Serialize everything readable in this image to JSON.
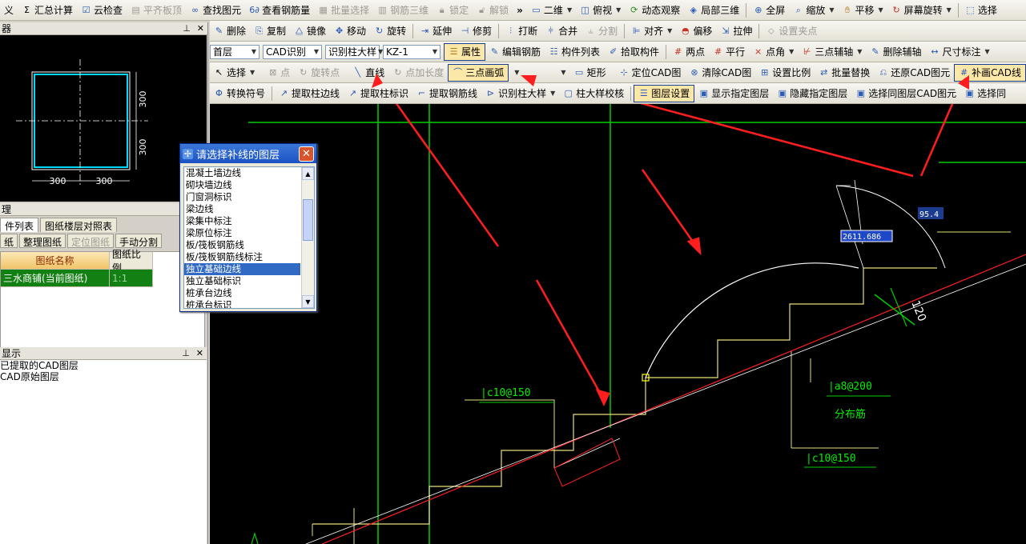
{
  "toolbar1": {
    "items": [
      "义",
      "汇总计算",
      "云检查",
      "平齐板顶",
      "查找图元",
      "查看钢筋量",
      "批量选择",
      "钢筋三维",
      "锁定",
      "解锁",
      "二维",
      "俯视",
      "动态观察",
      "局部三维",
      "全屏",
      "缩放",
      "平移",
      "屏幕旋转",
      "选择"
    ]
  },
  "toolbar2": {
    "panel_title": "器",
    "items": [
      "删除",
      "复制",
      "镜像",
      "移动",
      "旋转",
      "延伸",
      "修剪",
      "打断",
      "合并",
      "分割",
      "对齐",
      "偏移",
      "拉伸",
      "设置夹点"
    ]
  },
  "toolbar3": {
    "floor": "首层",
    "cad_recognize": "CAD识别",
    "recognize_col": "识别柱大样",
    "element": "KZ-1",
    "items": [
      "属性",
      "编辑钢筋",
      "构件列表",
      "拾取构件",
      "两点",
      "平行",
      "点角",
      "三点辅轴",
      "删除辅轴",
      "尺寸标注"
    ]
  },
  "toolbar4": {
    "items": [
      "选择",
      "点",
      "旋转点",
      "直线",
      "点加长度",
      "三点画弧",
      "矩形",
      "定位CAD图",
      "清除CAD图",
      "设置比例",
      "批量替换",
      "还原CAD图元",
      "补画CAD线"
    ]
  },
  "toolbar5": {
    "items": [
      "转换符号",
      "提取柱边线",
      "提取柱标识",
      "提取钢筋线",
      "识别柱大样",
      "柱大样校核",
      "图层设置",
      "显示指定图层",
      "隐藏指定图层",
      "选择同图层CAD图元",
      "选择同"
    ]
  },
  "preview": {
    "dim_v1": "300",
    "dim_v2": "300",
    "dim_h1": "300",
    "dim_h2": "300"
  },
  "drawings_panel": {
    "title": "理",
    "tabs": [
      "件列表",
      "图纸楼层对照表"
    ],
    "buttons": [
      "纸",
      "整理图纸",
      "定位图纸",
      "手动分割"
    ],
    "headers": [
      "图纸名称",
      "图纸比例"
    ],
    "rows": [
      {
        "name": "三水商铺(当前图纸)",
        "scale": "1:1"
      }
    ]
  },
  "layer_panel": {
    "title": "显示",
    "items": [
      "已提取的CAD图层",
      "CAD原始图层"
    ]
  },
  "dialog": {
    "title": "请选择补线的图层",
    "options": [
      "混凝土墙边线",
      "砌块墙边线",
      "门窗洞标识",
      "梁边线",
      "梁集中标注",
      "梁原位标注",
      "板/筏板钢筋线",
      "板/筏板钢筋线标注",
      "独立基础边线",
      "独立基础标识",
      "桩承台边线",
      "桩承台标识"
    ],
    "selected": "独立基础边线"
  },
  "cad": {
    "label1": "|c10@150",
    "label2": "|a8@200",
    "label3": "分布筋",
    "label4": "|c10@150",
    "dim120": "120",
    "angle_value": "95.4",
    "length_value": "2611.686"
  },
  "colors": {
    "cad_green": "#00cc00",
    "cad_yellow": "#e8e07a",
    "cad_red": "#ff2020",
    "selection": "#316ac5"
  }
}
